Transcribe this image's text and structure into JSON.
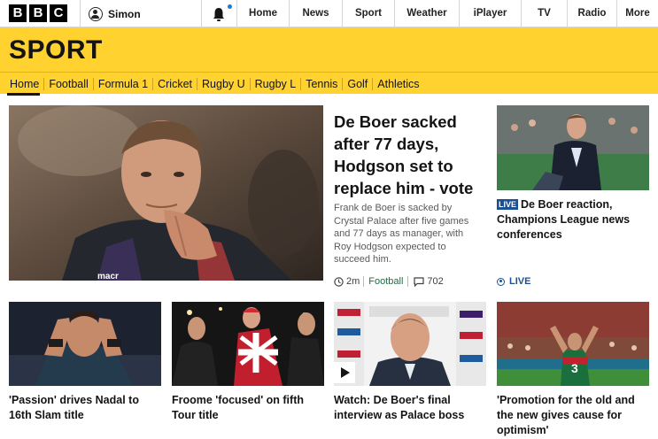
{
  "top_nav": {
    "logo_letters": [
      "B",
      "B",
      "C"
    ],
    "account_name": "Simon",
    "items": [
      "Home",
      "News",
      "Sport",
      "Weather",
      "iPlayer",
      "TV",
      "Radio",
      "More"
    ]
  },
  "section": {
    "title": "SPORT",
    "nav": [
      "Home",
      "Football",
      "Formula 1",
      "Cricket",
      "Rugby U",
      "Rugby L",
      "Tennis",
      "Golf",
      "Athletics"
    ],
    "active": "Home"
  },
  "lead_story": {
    "headline": "De Boer sacked after 77 days, Hodgson set to replace him - vote",
    "summary": "Frank de Boer is sacked by Crystal Palace after five games and 77 days as manager, with Roy Hodgson expected to succeed him.",
    "time": "2m",
    "topic": "Football",
    "comments": "702"
  },
  "side_story": {
    "live_badge": "LIVE",
    "headline": "De Boer reaction, Champions League news conferences",
    "live_label": "LIVE"
  },
  "cards": [
    {
      "title": "'Passion' drives Nadal to 16th Slam title"
    },
    {
      "title": "Froome 'focused' on fifth Tour title"
    },
    {
      "title": "Watch: De Boer's final interview as Palace boss"
    },
    {
      "title": "'Promotion for the old and the new gives cause for optimism'"
    }
  ],
  "colors": {
    "sport_yellow": "#ffd230",
    "live_blue": "#1d4f91",
    "topic_green": "#1b6f42"
  },
  "icons": [
    "user-icon",
    "bell-icon",
    "clock-icon",
    "comment-icon",
    "live-icon",
    "play-icon"
  ]
}
